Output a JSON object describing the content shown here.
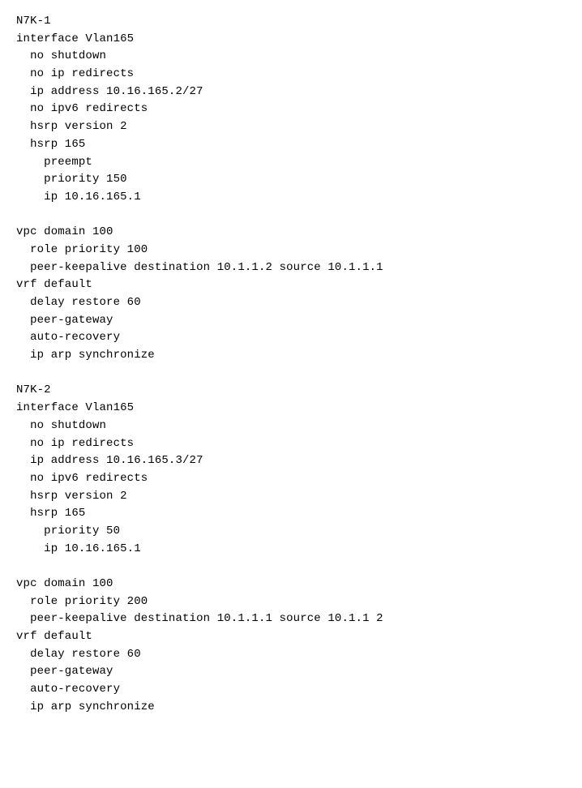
{
  "content": {
    "sections": [
      {
        "id": "n7k1-section",
        "lines": [
          "N7K-1",
          "interface Vlan165",
          "  no shutdown",
          "  no ip redirects",
          "  ip address 10.16.165.2/27",
          "  no ipv6 redirects",
          "  hsrp version 2",
          "  hsrp 165",
          "    preempt",
          "    priority 150",
          "    ip 10.16.165.1",
          "",
          "vpc domain 100",
          "  role priority 100",
          "  peer-keepalive destination 10.1.1.2 source 10.1.1.1",
          "vrf default",
          "  delay restore 60",
          "  peer-gateway",
          "  auto-recovery",
          "  ip arp synchronize"
        ]
      },
      {
        "id": "n7k2-section",
        "lines": [
          "",
          "N7K-2",
          "interface Vlan165",
          "  no shutdown",
          "  no ip redirects",
          "  ip address 10.16.165.3/27",
          "  no ipv6 redirects",
          "  hsrp version 2",
          "  hsrp 165",
          "    priority 50",
          "    ip 10.16.165.1",
          "",
          "vpc domain 100",
          "  role priority 200",
          "  peer-keepalive destination 10.1.1.1 source 10.1.1 2",
          "vrf default",
          "  delay restore 60",
          "  peer-gateway",
          "  auto-recovery",
          "  ip arp synchronize"
        ]
      }
    ]
  }
}
